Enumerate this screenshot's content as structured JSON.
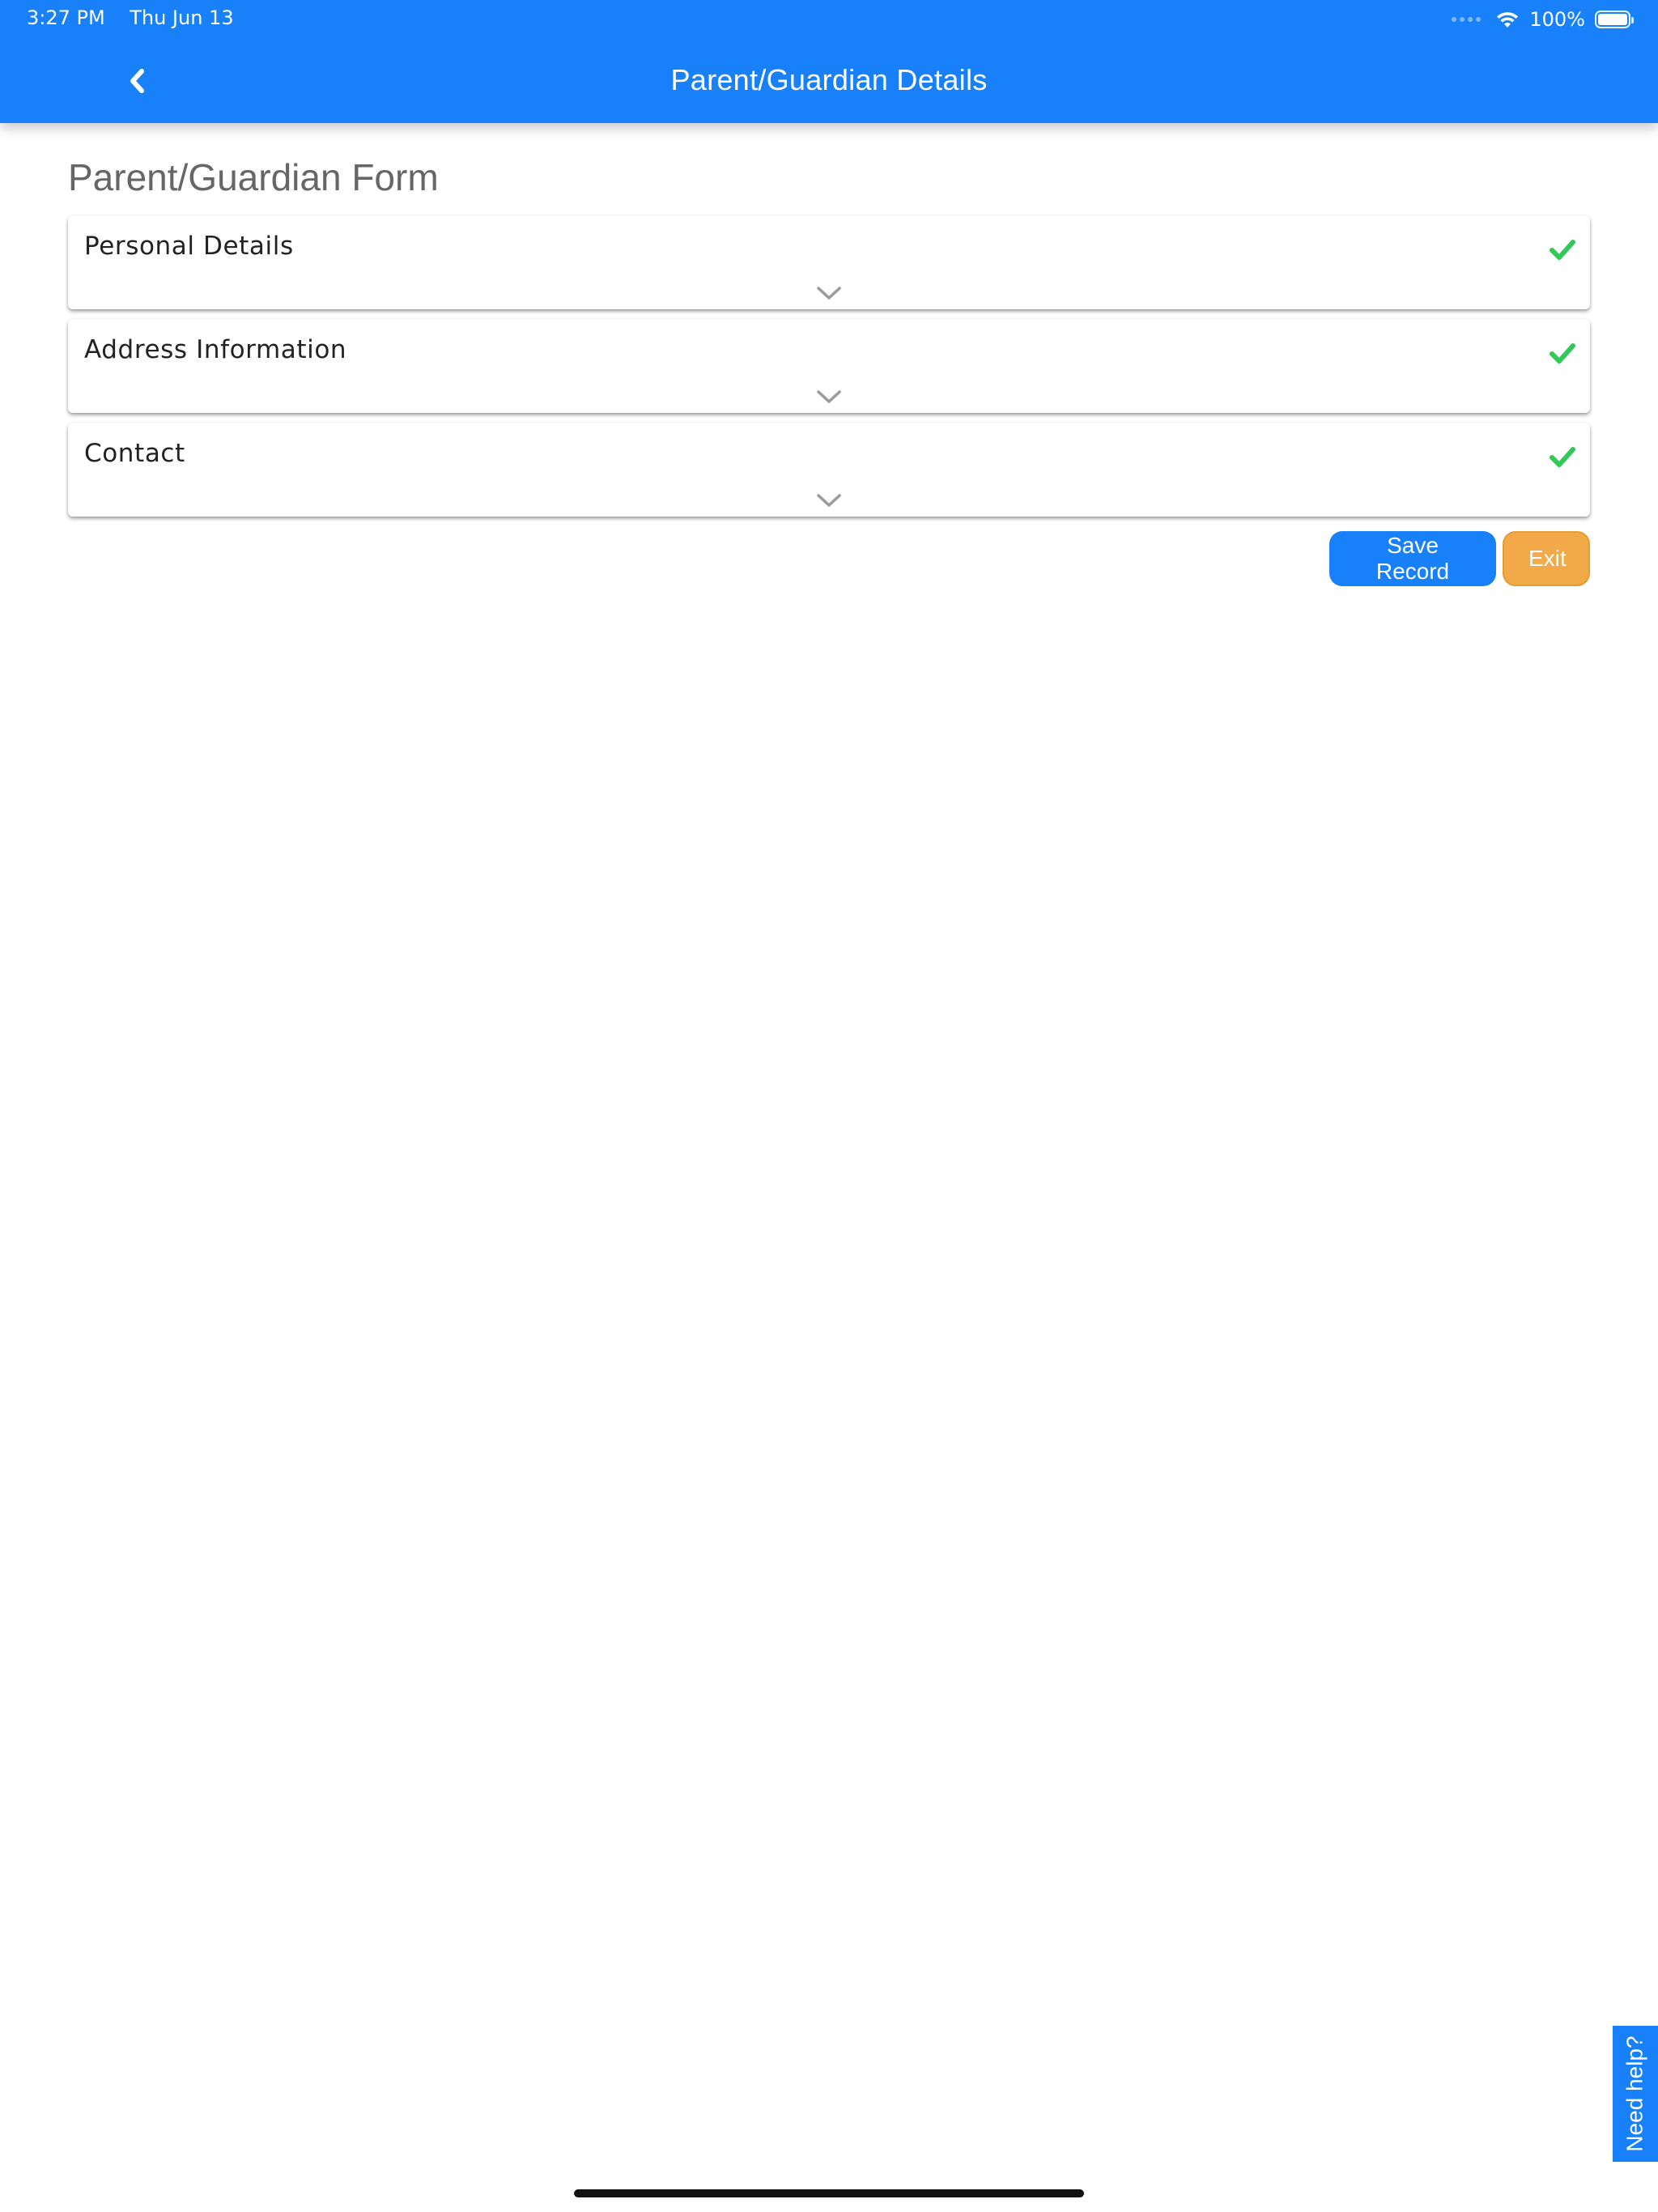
{
  "status_bar": {
    "time": "3:27 PM",
    "date": "Thu Jun 13",
    "battery_percent": "100%",
    "battery_level": 1.0,
    "icons": [
      "signal-dots-icon",
      "wifi-icon",
      "battery-icon"
    ]
  },
  "header": {
    "title": "Parent/Guardian Details",
    "back_icon": "chevron-left-icon",
    "background_color": "#1880f8"
  },
  "form": {
    "title": "Parent/Guardian Form",
    "sections": [
      {
        "label": "Personal Details",
        "status_icon": "check-icon",
        "expand_icon": "chevron-down-icon"
      },
      {
        "label": "Address Information",
        "status_icon": "check-icon",
        "expand_icon": "chevron-down-icon"
      },
      {
        "label": "Contact",
        "status_icon": "check-icon",
        "expand_icon": "chevron-down-icon"
      }
    ],
    "check_color": "#2ecc40"
  },
  "actions": {
    "save_label": "Save Record",
    "exit_label": "Exit",
    "save_color": "#1880f8",
    "exit_color": "#f2aa48"
  },
  "help": {
    "label": "Need help?"
  }
}
